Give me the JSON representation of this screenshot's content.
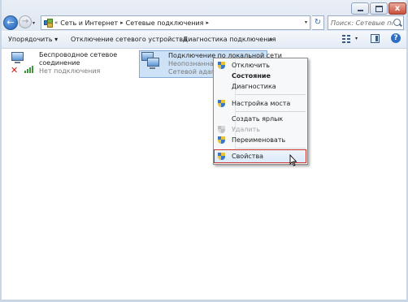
{
  "window": {
    "caption_buttons": [
      "minimize",
      "maximize",
      "close"
    ],
    "close_glyph": "x"
  },
  "nav": {
    "back_glyph": "←",
    "forward_glyph": "→",
    "recent_glyph": "▾"
  },
  "address": {
    "lead_sep": "«",
    "crumbs": [
      "Сеть и Интернет",
      "Сетевые подключения"
    ],
    "sep": "▸",
    "dropdown_glyph": "▾",
    "refresh_glyph": "↻"
  },
  "search": {
    "placeholder": "Поиск: Сетевые подключения"
  },
  "toolbar": {
    "organize_label": "Упорядочить ▾",
    "disable_label": "Отключение сетевого устройства",
    "diagnose_label": "Диагностика подключения",
    "more_label": "»",
    "view_dd": "▾",
    "help_glyph": "?"
  },
  "connections": [
    {
      "name_line1": "Беспроводное сетевое",
      "name_line2": "соединение",
      "status": "Нет подключения",
      "error_glyph": "✕"
    },
    {
      "name": "Подключение по локальной сети",
      "status": "Неопознанная с",
      "adapter": "Сетевой адаптер"
    }
  ],
  "context_menu": {
    "items": [
      {
        "label": "Отключить",
        "icon": "shield-icon"
      },
      {
        "label": "Состояние",
        "bold": true
      },
      {
        "label": "Диагностика"
      },
      {
        "label": "Настройка моста",
        "icon": "shield-icon"
      },
      {
        "label": "Создать ярлык"
      },
      {
        "label": "Удалить",
        "icon": "shield-icon",
        "disabled": true
      },
      {
        "label": "Переименовать",
        "icon": "shield-icon"
      },
      {
        "label": "Свойства",
        "icon": "shield-icon",
        "highlighted": true
      }
    ]
  },
  "colors": {
    "selection": "#cde1f7",
    "highlight_border": "#c9302c",
    "toolbar": "#e3ebf5"
  }
}
